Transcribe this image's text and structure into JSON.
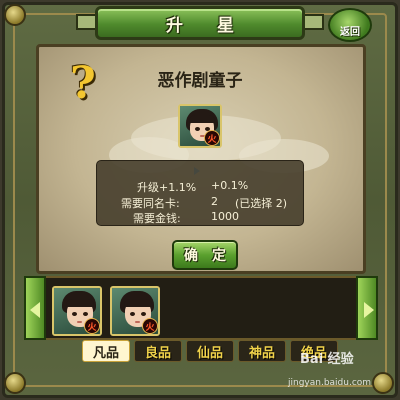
{
  "title": {
    "char1": "升",
    "char2": "星"
  },
  "back_button": {
    "label": "返回"
  },
  "card_detail": {
    "name": "恶作剧童子",
    "element": "火",
    "hint_icon": "question-icon"
  },
  "upgrade_info": {
    "level_label": "升级+1.1%",
    "level_value": "+0.1%",
    "same_card_label": "需要同名卡:",
    "same_card_value": "2",
    "same_card_selected": "(已选择 2)",
    "gold_label": "需要金钱:",
    "gold_value": "1000"
  },
  "confirm_button": {
    "char1": "确",
    "char2": "定"
  },
  "card_strip": [
    {
      "element": "火"
    },
    {
      "element": "火"
    }
  ],
  "tabs": [
    {
      "label": "凡品",
      "active": true
    },
    {
      "label": "良品",
      "active": false
    },
    {
      "label": "仙品",
      "active": false
    },
    {
      "label": "神品",
      "active": false
    },
    {
      "label": "绝品",
      "active": false
    }
  ],
  "watermark": {
    "logo": "Bai 经验",
    "url": "jingyan.baidu.com"
  },
  "colors": {
    "frame": "#556140",
    "banner": "#4f8a2c",
    "parchment": "#c3b592",
    "tab_text": "#f0d24a",
    "element_fire": "#ff5a2a"
  }
}
